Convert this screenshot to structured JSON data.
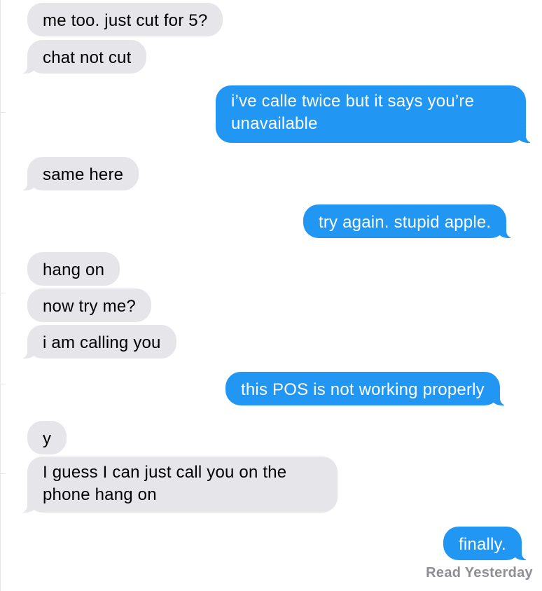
{
  "conversation": {
    "messages": [
      {
        "from": "them",
        "text": "me too. just cut for 5?"
      },
      {
        "from": "them",
        "text": "chat not cut"
      },
      {
        "from": "me",
        "text": "i’ve calle twice but it says you’re unavailable"
      },
      {
        "from": "them",
        "text": "same here"
      },
      {
        "from": "me",
        "text": "try again. stupid apple."
      },
      {
        "from": "them",
        "text": "hang on"
      },
      {
        "from": "them",
        "text": "now try me?"
      },
      {
        "from": "them",
        "text": "i am calling you"
      },
      {
        "from": "me",
        "text": "this POS is not working properly"
      },
      {
        "from": "them",
        "text": "y"
      },
      {
        "from": "them",
        "text": "I guess I can just call you on the phone hang on"
      },
      {
        "from": "me",
        "text": "finally."
      }
    ],
    "read_receipt": "Read Yesterday"
  },
  "colors": {
    "sent_bubble": "#2196f3",
    "received_bubble": "#e5e5ea",
    "read_receipt_text": "#8e8e93"
  }
}
